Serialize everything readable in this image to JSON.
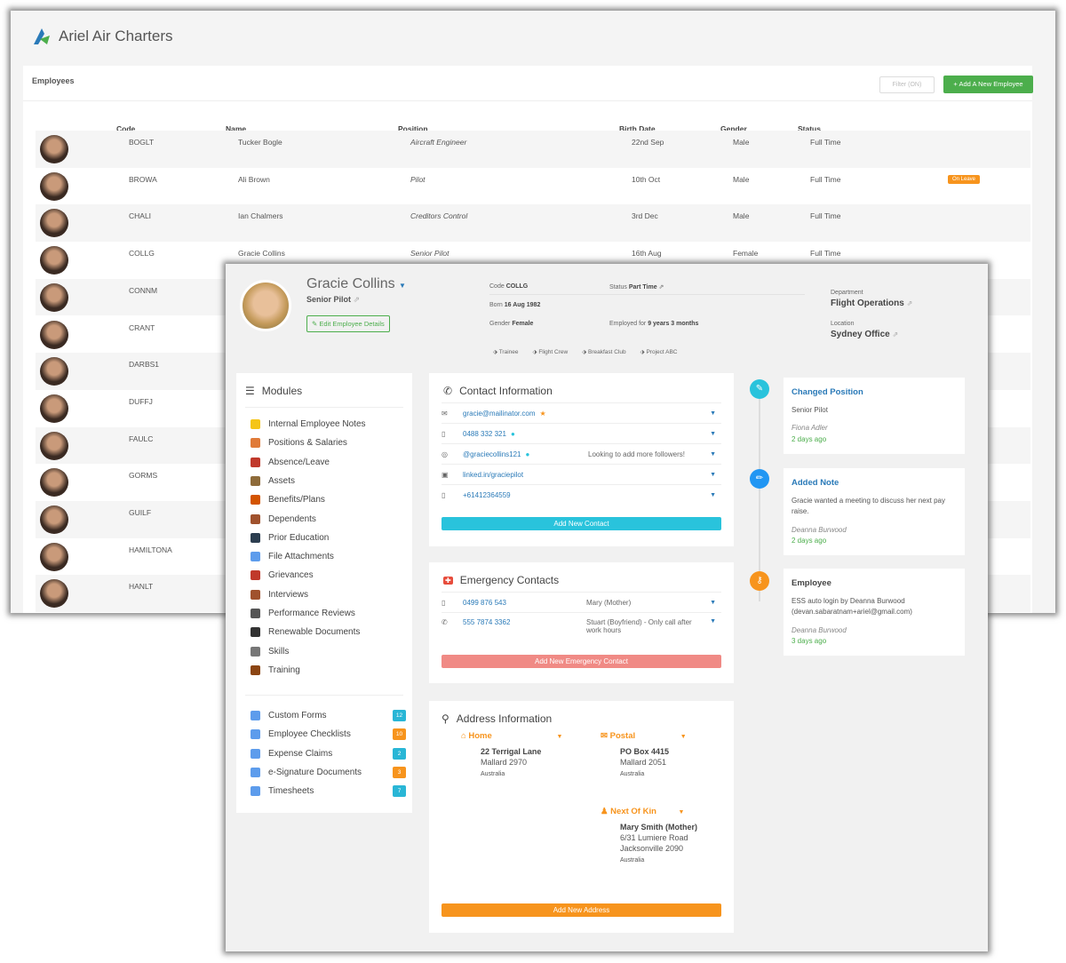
{
  "app": {
    "title": "Ariel Air Charters"
  },
  "employees": {
    "heading": "Employees",
    "filter_label": "Filter (ON)",
    "add_label": "+ Add A New Employee",
    "columns": [
      "Code",
      "Name",
      "Position",
      "Birth Date",
      "Gender",
      "Status"
    ],
    "rows": [
      {
        "code": "BOGLT",
        "name": "Tucker Bogle",
        "position": "Aircraft Engineer",
        "birth": "22nd Sep",
        "gender": "Male",
        "status": "Full Time"
      },
      {
        "code": "BROWA",
        "name": "Ali Brown",
        "position": "Pilot",
        "birth": "10th Oct",
        "gender": "Male",
        "status": "Full Time",
        "badge": "On Leave"
      },
      {
        "code": "CHALI",
        "name": "Ian Chalmers",
        "position": "Creditors Control",
        "birth": "3rd Dec",
        "gender": "Male",
        "status": "Full Time"
      },
      {
        "code": "COLLG",
        "name": "Gracie Collins",
        "position": "Senior Pilot",
        "birth": "16th Aug",
        "gender": "Female",
        "status": "Full Time"
      },
      {
        "code": "CONNM"
      },
      {
        "code": "CRANT"
      },
      {
        "code": "DARBS1"
      },
      {
        "code": "DUFFJ"
      },
      {
        "code": "FAULC"
      },
      {
        "code": "GORMS"
      },
      {
        "code": "GUILF"
      },
      {
        "code": "HAMILTONA"
      },
      {
        "code": "HANLT"
      }
    ]
  },
  "profile": {
    "name": "Gracie Collins",
    "position": "Senior Pilot",
    "edit_label": "Edit Employee Details",
    "code_label": "Code",
    "code": "COLLG",
    "status_label": "Status",
    "status": "Part Time",
    "born_label": "Born",
    "born": "16 Aug 1982",
    "gender_label": "Gender",
    "gender": "Female",
    "employed_label": "Employed for",
    "employed": "9 years 3 months",
    "tags": [
      "Trainee",
      "Flight Crew",
      "Breakfast Club",
      "Project ABC"
    ],
    "department_label": "Department",
    "department": "Flight Operations",
    "location_label": "Location",
    "location": "Sydney Office"
  },
  "modules": {
    "title": "Modules",
    "items": [
      "Internal Employee Notes",
      "Positions & Salaries",
      "Absence/Leave",
      "Assets",
      "Benefits/Plans",
      "Dependents",
      "Prior Education",
      "File Attachments",
      "Grievances",
      "Interviews",
      "Performance Reviews",
      "Renewable Documents",
      "Skills",
      "Training"
    ],
    "extras": [
      {
        "label": "Custom Forms",
        "count": "12",
        "color": "#29b6d6"
      },
      {
        "label": "Employee Checklists",
        "count": "10",
        "color": "#f7941d"
      },
      {
        "label": "Expense Claims",
        "count": "2",
        "color": "#29b6d6"
      },
      {
        "label": "e-Signature Documents",
        "count": "3",
        "color": "#f7941d"
      },
      {
        "label": "Timesheets",
        "count": "7",
        "color": "#29b6d6"
      }
    ]
  },
  "contact": {
    "title": "Contact Information",
    "add_label": "Add New Contact",
    "rows": [
      {
        "value": "gracie@mailinator.com",
        "note": ""
      },
      {
        "value": "0488 332 321",
        "note": ""
      },
      {
        "value": "@graciecollins121",
        "note": "Looking to add more followers!"
      },
      {
        "value": "linked.in/graciepilot",
        "note": ""
      },
      {
        "value": "+61412364559",
        "note": ""
      }
    ]
  },
  "emergency": {
    "title": "Emergency Contacts",
    "add_label": "Add New Emergency Contact",
    "rows": [
      {
        "value": "0499 876 543",
        "note": "Mary (Mother)"
      },
      {
        "value": "555 7874 3362",
        "note": "Stuart (Boyfriend) - Only call after work hours"
      }
    ]
  },
  "address": {
    "title": "Address Information",
    "add_label": "Add New Address",
    "home": {
      "title": "Home",
      "line1": "22 Terrigal Lane",
      "line2": "Mallard 2970",
      "country": "Australia"
    },
    "postal": {
      "title": "Postal",
      "line1": "PO Box 4415",
      "line2": "Mallard 2051",
      "country": "Australia"
    },
    "kin": {
      "title": "Next Of Kin",
      "name": "Mary Smith (Mother)",
      "line1": "6/31 Lumiere Road",
      "line2": "Jacksonville 2090",
      "country": "Australia"
    }
  },
  "timeline": [
    {
      "title": "Changed Position",
      "body": "Senior Pilot",
      "by": "Fiona Adler",
      "ago": "2 days ago"
    },
    {
      "title": "Added Note",
      "body": "Gracie wanted a meeting to discuss her next pay raise.",
      "by": "Deanna Burwood",
      "ago": "2 days ago"
    },
    {
      "title": "Employee",
      "body": "ESS auto login by Deanna Burwood (devan.sabaratnam+ariel@gmail.com)",
      "by": "Deanna Burwood",
      "ago": "3 days ago"
    }
  ],
  "colors": {
    "green": "#4cae4c",
    "cyan": "#29c3dc",
    "orange": "#f7941d",
    "blue": "#2a7ab8",
    "red": "#f08a85"
  }
}
